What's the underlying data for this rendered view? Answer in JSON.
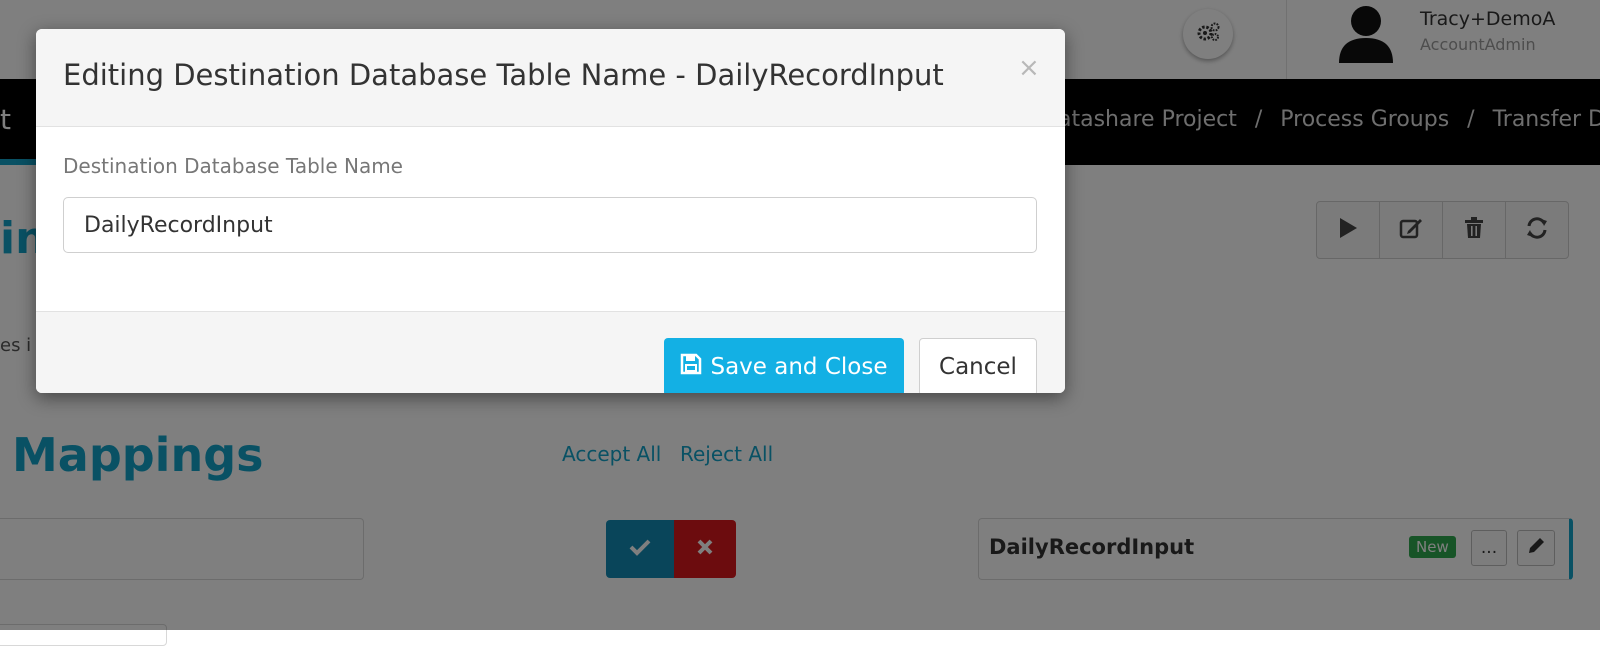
{
  "topbar": {
    "user_name": "Tracy+DemoA",
    "user_role": "AccountAdmin"
  },
  "navbar": {
    "title_fragment": "t",
    "breadcrumb": [
      "atashare Project",
      "Process Groups",
      "Transfer D"
    ],
    "separator": "/"
  },
  "main": {
    "heading_fragment": "in",
    "description_fragment": "es i",
    "mappings_title": "Mappings",
    "accept_all": "Accept All",
    "reject_all": "Reject All",
    "mapping_row": {
      "destination_name": "DailyRecordInput",
      "badge": "New",
      "more_label": "..."
    }
  },
  "modal": {
    "title": "Editing Destination Database Table Name - DailyRecordInput",
    "close_label": "×",
    "field_label": "Destination Database Table Name",
    "field_value": "DailyRecordInput",
    "save_label": "Save and Close",
    "cancel_label": "Cancel"
  },
  "colors": {
    "accent": "#13a3c9",
    "save_button": "#13b0e4",
    "reject": "#d9181c",
    "badge_new": "#2fa84f"
  },
  "icons": [
    "gears-icon",
    "user-icon",
    "play-icon",
    "edit-icon",
    "trash-icon",
    "refresh-icon",
    "check-icon",
    "x-icon",
    "pencil-icon",
    "save-icon",
    "close-icon"
  ]
}
